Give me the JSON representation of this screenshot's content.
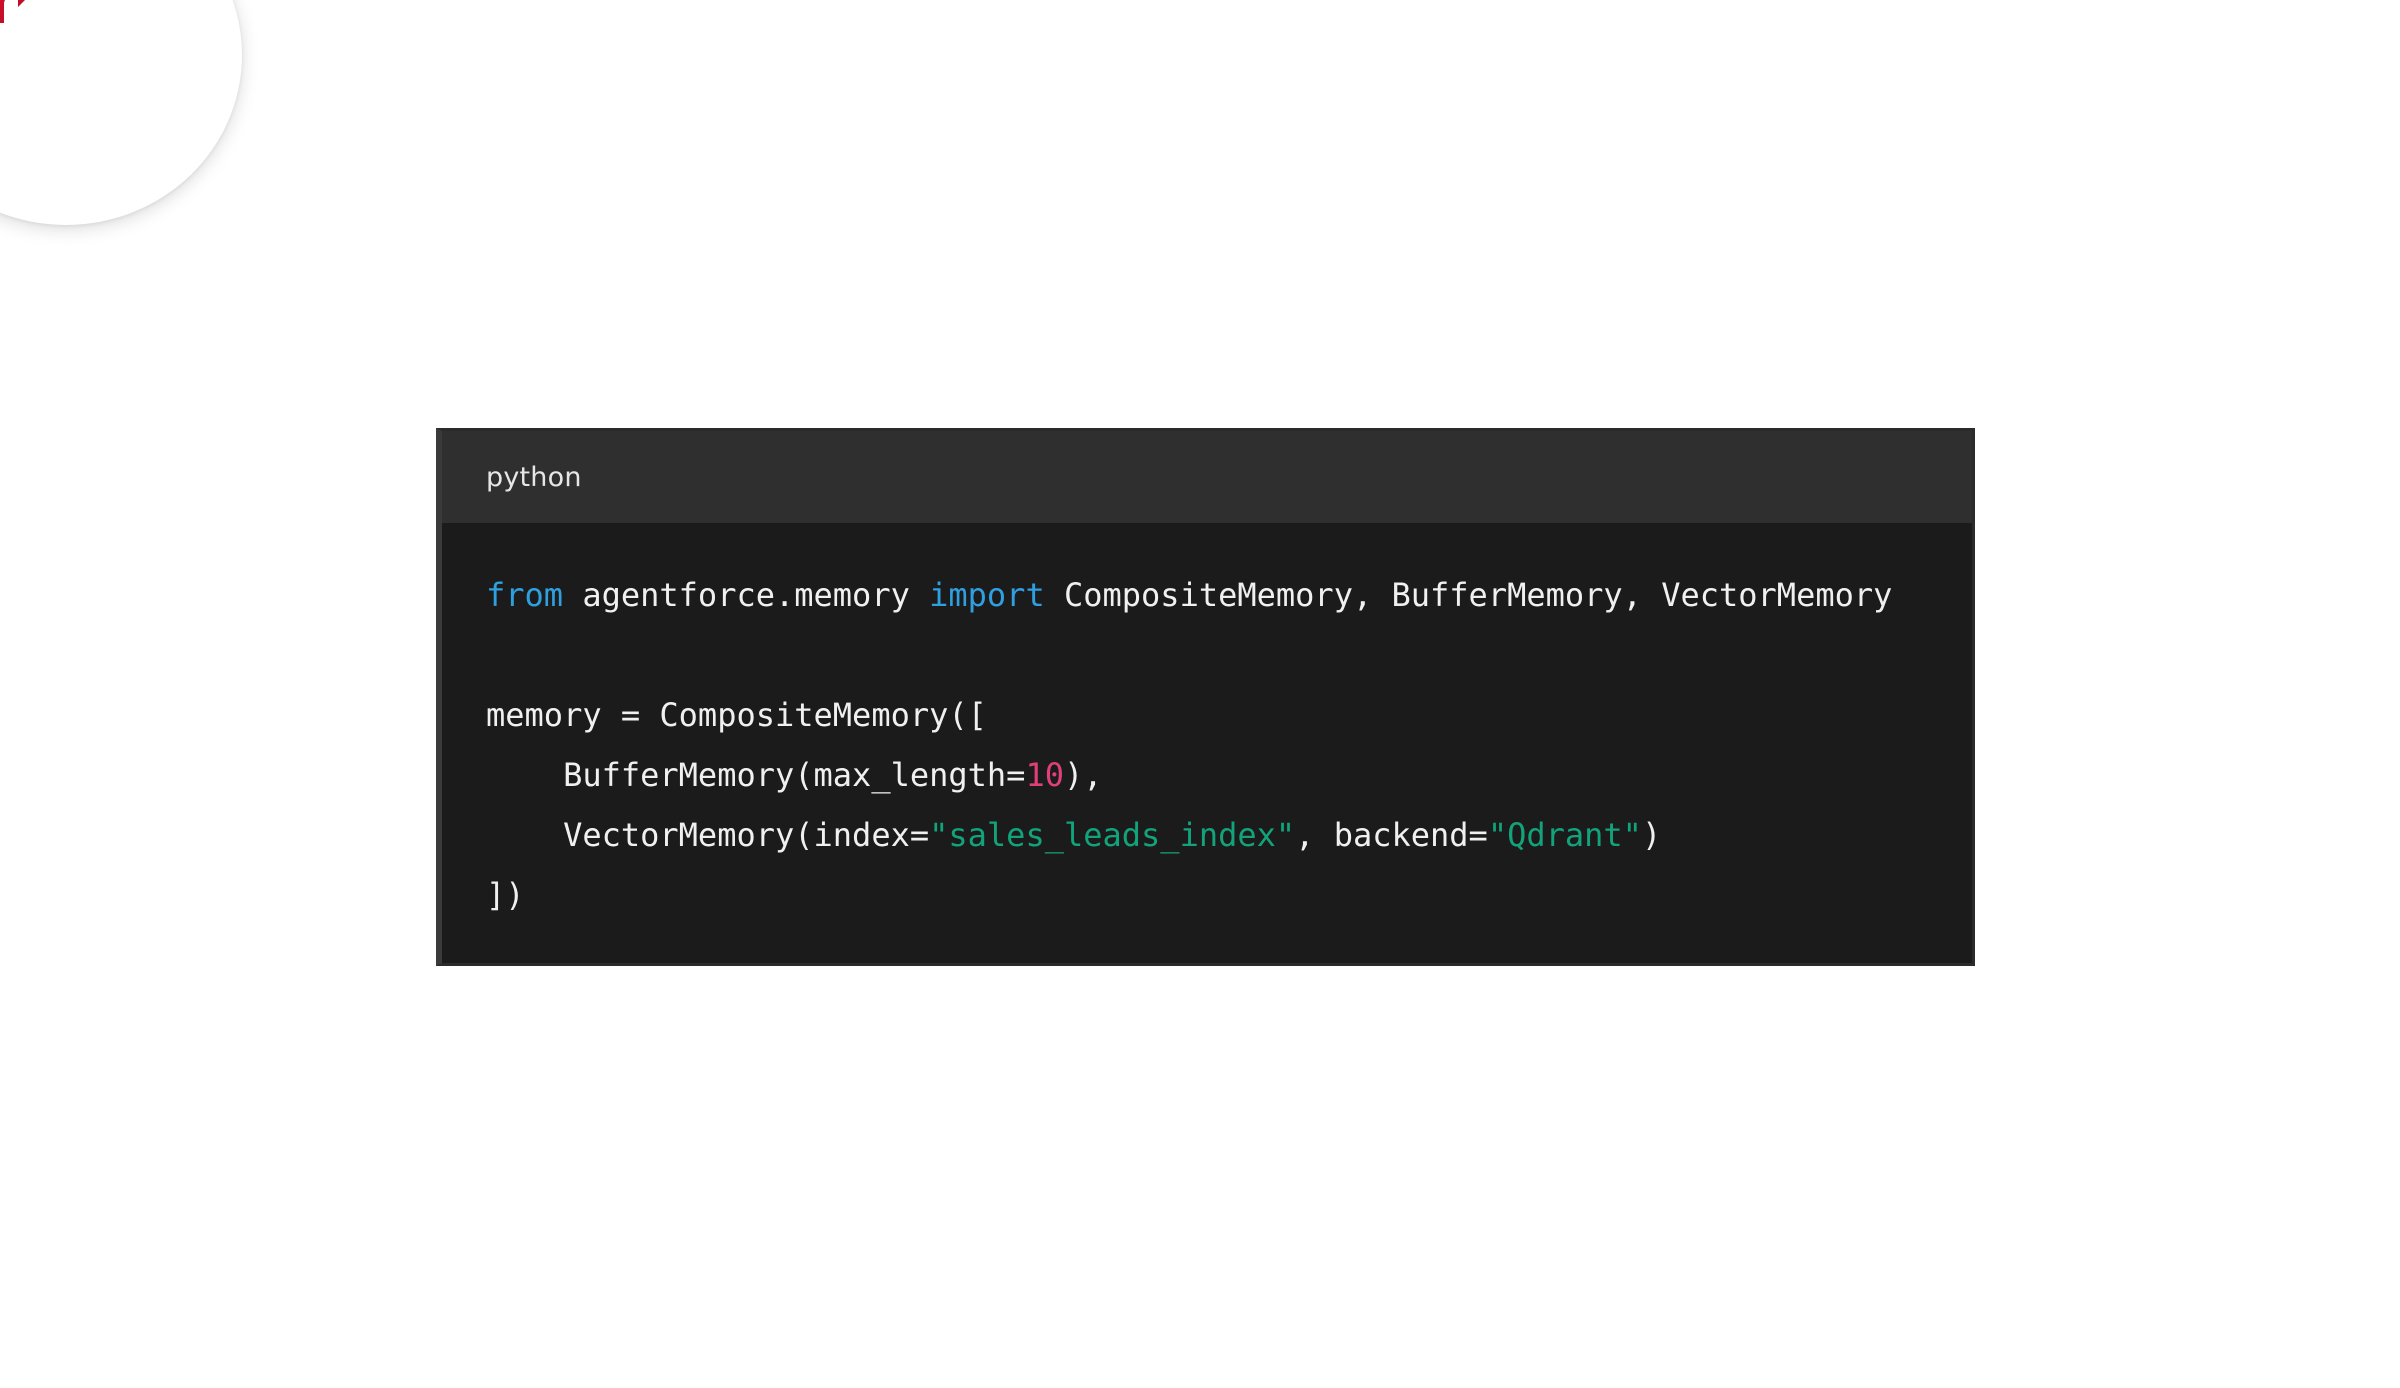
{
  "brand": {
    "logo_icon": "agentforce-logo-icon",
    "colors": {
      "blue": "#1f6fe5",
      "red": "#d3102a"
    }
  },
  "code_block": {
    "language": "python",
    "colors": {
      "keyword": "#2f9fe0",
      "number": "#e0407a",
      "string": "#12a37a",
      "text": "#f0f0f0",
      "background": "#1b1b1b",
      "header_background": "#2f2f2f"
    },
    "lines": [
      {
        "tokens": [
          {
            "t": "kw",
            "v": "from"
          },
          {
            "t": "txt",
            "v": " agentforce.memory "
          },
          {
            "t": "kw",
            "v": "import"
          },
          {
            "t": "txt",
            "v": " CompositeMemory, BufferMemory, VectorMemory"
          }
        ]
      },
      {
        "tokens": []
      },
      {
        "tokens": [
          {
            "t": "txt",
            "v": "memory = CompositeMemory(["
          }
        ]
      },
      {
        "tokens": [
          {
            "t": "txt",
            "v": "    BufferMemory(max_length="
          },
          {
            "t": "num",
            "v": "10"
          },
          {
            "t": "txt",
            "v": "),"
          }
        ]
      },
      {
        "tokens": [
          {
            "t": "txt",
            "v": "    VectorMemory(index="
          },
          {
            "t": "str",
            "v": "\"sales_leads_index\""
          },
          {
            "t": "txt",
            "v": ", backend="
          },
          {
            "t": "str",
            "v": "\"Qdrant\""
          },
          {
            "t": "txt",
            "v": ")"
          }
        ]
      },
      {
        "tokens": [
          {
            "t": "txt",
            "v": "])"
          }
        ]
      }
    ]
  }
}
